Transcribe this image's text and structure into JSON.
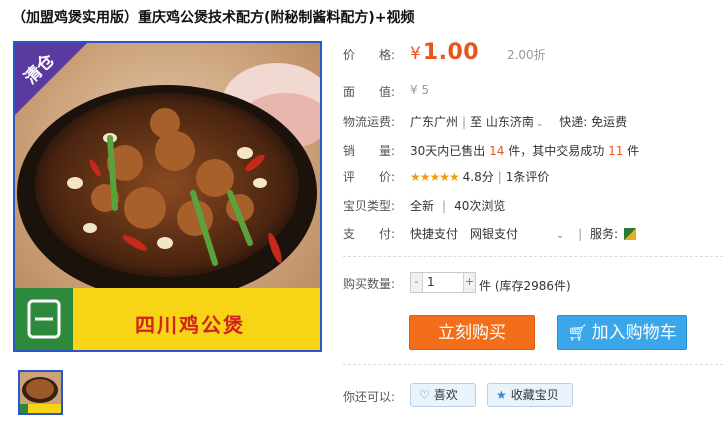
{
  "title": "（加盟鸡煲实用版）重庆鸡公煲技术配方(附秘制酱料配方)+视频",
  "image": {
    "badge": "清仓",
    "banner_text": "四川鸡公煲"
  },
  "price": {
    "label": "价　　格:",
    "currency": "¥",
    "value": "1.00",
    "discount": "2.00折"
  },
  "face_value": {
    "label": "面　　值:",
    "value": "¥ 5"
  },
  "shipping": {
    "label": "物流运费:",
    "from": "广东广州",
    "to_word": "至",
    "to": "山东济南",
    "express": "快递: 免运费"
  },
  "sales": {
    "label": "销　　量:",
    "prefix": "30天内已售出",
    "sold": "14",
    "mid": "件，其中交易成功",
    "success": "11",
    "suffix": "件"
  },
  "rating": {
    "label": "评　　价:",
    "stars": "★★★★★",
    "score": "4.8分",
    "reviews": "1条评价"
  },
  "item_type": {
    "label": "宝贝类型:",
    "condition": "全新",
    "views": "40次浏览"
  },
  "payment": {
    "label": "支　　付:",
    "methods": "快捷支付　网银支付",
    "service_label": "服务:"
  },
  "purchase": {
    "label": "购买数量:",
    "qty": "1",
    "stock": "件 (库存2986件)"
  },
  "buttons": {
    "buy_now": "立刻购买",
    "add_cart": "加入购物车"
  },
  "share": {
    "label": "你还可以:",
    "like": "喜欢",
    "favorite": "收藏宝贝"
  },
  "colors": {
    "accent": "#e8551c",
    "buy": "#f26e1a",
    "cart": "#3ba6ea",
    "border": "#2b56c9"
  }
}
